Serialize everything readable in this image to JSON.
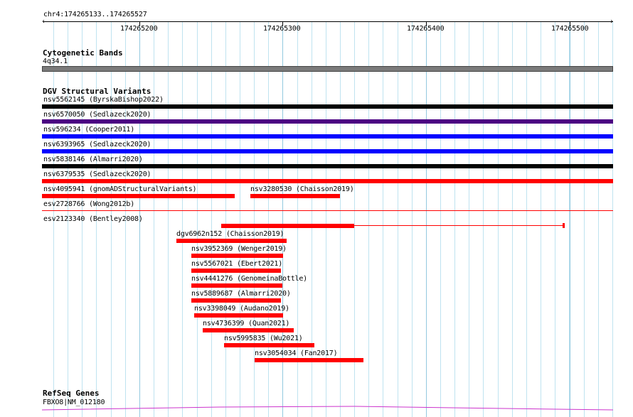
{
  "ruler": {
    "location": "chr4:174265133..174265527",
    "ticks": [
      "174265200",
      "174265300",
      "174265400",
      "174265500"
    ]
  },
  "tracks": {
    "cytoband": {
      "title": "Cytogenetic Bands",
      "band": "4q34.1"
    },
    "dgv": {
      "title": "DGV Structural Variants",
      "features": [
        {
          "label": "nsv5562145 (ByrskaBishop2022)",
          "color": "#000000"
        },
        {
          "label": "nsv6570050 (Sedlazeck2020)",
          "color": "#4b0082"
        },
        {
          "label": "nsv596234 (Cooper2011)",
          "color": "#0000ff"
        },
        {
          "label": "nsv6393965 (Sedlazeck2020)",
          "color": "#0000ff"
        },
        {
          "label": "nsv5838146 (Almarri2020)",
          "color": "#000000"
        },
        {
          "label": "nsv6379535 (Sedlazeck2020)",
          "color": "#ff0000"
        },
        {
          "label": "nsv4095941 (gnomADStructuralVariants)",
          "color": "#ff0000"
        },
        {
          "label": "nsv3280530 (Chaisson2019)",
          "color": "#ff0000"
        },
        {
          "label": "esv2728766 (Wong2012b)",
          "color": "#ff0000"
        },
        {
          "label": "esv2123340 (Bentley2008)",
          "color": "#ff0000"
        },
        {
          "label": "dgv6962n152 (Chaisson2019)",
          "color": "#ff0000"
        },
        {
          "label": "nsv3952369 (Wenger2019)",
          "color": "#ff0000"
        },
        {
          "label": "nsv5567021 (Ebert2021)",
          "color": "#ff0000"
        },
        {
          "label": "nsv4441276 (GenomeinaBottle)",
          "color": "#ff0000"
        },
        {
          "label": "nsv5889687 (Almarri2020)",
          "color": "#ff0000"
        },
        {
          "label": "nsv3398049 (Audano2019)",
          "color": "#ff0000"
        },
        {
          "label": "nsv4736399 (Quan2021)",
          "color": "#ff0000"
        },
        {
          "label": "nsv5995835 (Wu2021)",
          "color": "#ff0000"
        },
        {
          "label": "nsv3054034 (Fan2017)",
          "color": "#ff0000"
        }
      ]
    },
    "refseq": {
      "title": "RefSeq Genes",
      "gene": "FBXO8|NM_012180",
      "color": "#cc33cc"
    }
  }
}
